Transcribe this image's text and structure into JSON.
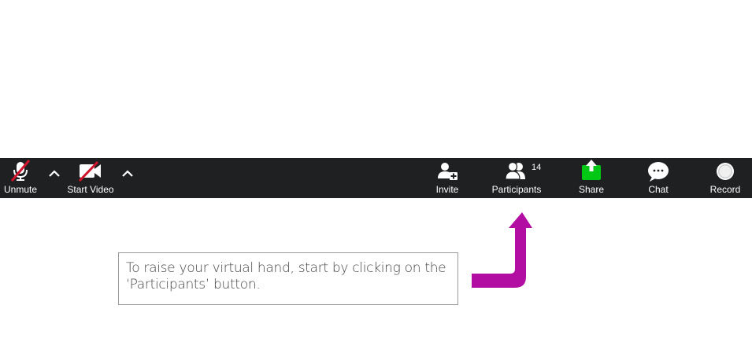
{
  "colors": {
    "toolbar_bg": "#1f2022",
    "mute_slash": "#d0142c",
    "share_green": "#00c814",
    "arrow_magenta": "#b20fa2",
    "text": "#ffffff"
  },
  "toolbar": {
    "left": [
      {
        "name": "unmute",
        "label": "Unmute",
        "icon": "microphone-muted-icon"
      },
      {
        "name": "start-video",
        "label": "Start Video",
        "icon": "video-camera-off-icon"
      }
    ],
    "right": [
      {
        "name": "invite",
        "label": "Invite",
        "icon": "add-user-icon"
      },
      {
        "name": "participants",
        "label": "Participants",
        "icon": "participants-icon",
        "count": "14"
      },
      {
        "name": "share",
        "label": "Share",
        "icon": "share-screen-icon"
      },
      {
        "name": "chat",
        "label": "Chat",
        "icon": "chat-bubble-icon"
      },
      {
        "name": "record",
        "label": "Record",
        "icon": "record-icon"
      }
    ]
  },
  "callout": {
    "text": "To raise your virtual hand, start by clicking on the ‘Participants’ button."
  }
}
